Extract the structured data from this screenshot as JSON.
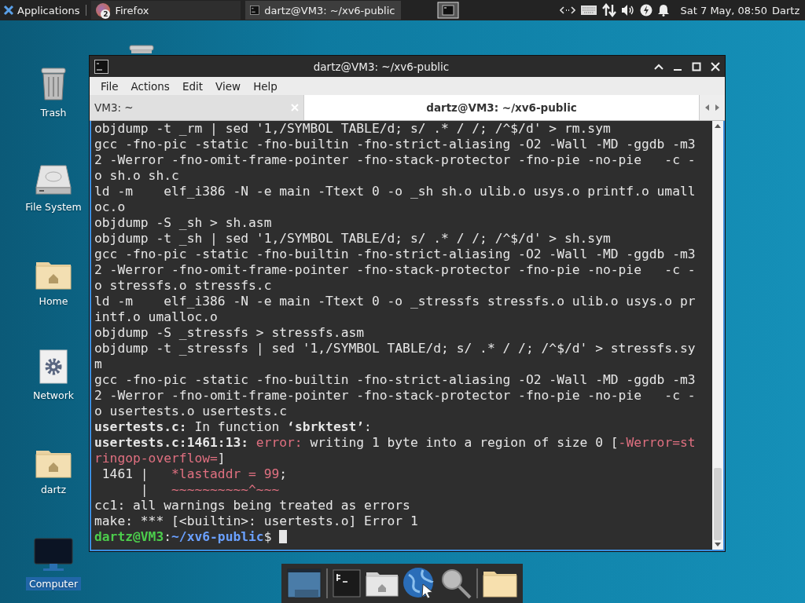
{
  "panel": {
    "menu_label": "Applications",
    "tasks": [
      {
        "label": "Firefox",
        "badge": "2",
        "kind": "browser",
        "selected": false
      },
      {
        "label": "dartz@VM3: ~/xv6-public",
        "kind": "terminal",
        "selected": true
      }
    ],
    "clock": "Sat  7 May, 08:50",
    "user": "Dartz"
  },
  "desktop_icons": [
    {
      "label": "Trash",
      "kind": "trash",
      "selected": false
    },
    {
      "label": "File System",
      "kind": "drive",
      "selected": false
    },
    {
      "label": "Home",
      "kind": "home",
      "selected": false
    },
    {
      "label": "Network",
      "kind": "network",
      "selected": false
    },
    {
      "label": "dartz",
      "kind": "home",
      "selected": false
    },
    {
      "label": "Computer",
      "kind": "computer",
      "selected": true
    }
  ],
  "window": {
    "title": "dartz@VM3: ~/xv6-public",
    "menu": [
      "File",
      "Actions",
      "Edit",
      "View",
      "Help"
    ],
    "tabs": [
      {
        "label": "VM3: ~",
        "selected": false
      },
      {
        "label": "dartz@VM3: ~/xv6-public",
        "selected": true
      }
    ],
    "lines": [
      [
        {
          "t": "objdump -t _rm | sed '1,/SYMBOL TABLE/d; s/ .* / /; /^$/d' > rm.sym",
          "kind": "plain"
        }
      ],
      [
        {
          "t": "gcc -fno-pic -static -fno-builtin -fno-strict-aliasing -O2 -Wall -MD -ggdb -m3",
          "kind": "plain"
        }
      ],
      [
        {
          "t": "2 -Werror -fno-omit-frame-pointer -fno-stack-protector -fno-pie -no-pie   -c -",
          "kind": "plain"
        }
      ],
      [
        {
          "t": "o sh.o sh.c",
          "kind": "plain"
        }
      ],
      [
        {
          "t": "ld -m    elf_i386 -N -e main -Ttext 0 -o _sh sh.o ulib.o usys.o printf.o umall",
          "kind": "plain"
        }
      ],
      [
        {
          "t": "oc.o",
          "kind": "plain"
        }
      ],
      [
        {
          "t": "objdump -S _sh > sh.asm",
          "kind": "plain"
        }
      ],
      [
        {
          "t": "objdump -t _sh | sed '1,/SYMBOL TABLE/d; s/ .* / /; /^$/d' > sh.sym",
          "kind": "plain"
        }
      ],
      [
        {
          "t": "gcc -fno-pic -static -fno-builtin -fno-strict-aliasing -O2 -Wall -MD -ggdb -m3",
          "kind": "plain"
        }
      ],
      [
        {
          "t": "2 -Werror -fno-omit-frame-pointer -fno-stack-protector -fno-pie -no-pie   -c -",
          "kind": "plain"
        }
      ],
      [
        {
          "t": "o stressfs.o stressfs.c",
          "kind": "plain"
        }
      ],
      [
        {
          "t": "ld -m    elf_i386 -N -e main -Ttext 0 -o _stressfs stressfs.o ulib.o usys.o pr",
          "kind": "plain"
        }
      ],
      [
        {
          "t": "intf.o umalloc.o",
          "kind": "plain"
        }
      ],
      [
        {
          "t": "objdump -S _stressfs > stressfs.asm",
          "kind": "plain"
        }
      ],
      [
        {
          "t": "objdump -t _stressfs | sed '1,/SYMBOL TABLE/d; s/ .* / /; /^$/d' > stressfs.sy",
          "kind": "plain"
        }
      ],
      [
        {
          "t": "m",
          "kind": "plain"
        }
      ],
      [
        {
          "t": "gcc -fno-pic -static -fno-builtin -fno-strict-aliasing -O2 -Wall -MD -ggdb -m3",
          "kind": "plain"
        }
      ],
      [
        {
          "t": "2 -Werror -fno-omit-frame-pointer -fno-stack-protector -fno-pie -no-pie   -c -",
          "kind": "plain"
        }
      ],
      [
        {
          "t": "o usertests.o usertests.c",
          "kind": "plain"
        }
      ],
      [
        {
          "t": "usertests.c:",
          "kind": "bold"
        },
        {
          "t": " In function ",
          "kind": "plain"
        },
        {
          "t": "‘sbrktest’",
          "kind": "bold"
        },
        {
          "t": ":",
          "kind": "plain"
        }
      ],
      [
        {
          "t": "usertests.c:1461:13: ",
          "kind": "bold"
        },
        {
          "t": "error:",
          "kind": "error"
        },
        {
          "t": " writing 1 byte into a region of size 0 [",
          "kind": "plain"
        },
        {
          "t": "-Werror=st",
          "kind": "error"
        }
      ],
      [
        {
          "t": "ringop-overflow=",
          "kind": "error"
        },
        {
          "t": "]",
          "kind": "plain"
        }
      ],
      [
        {
          "t": " 1461 |   ",
          "kind": "plain"
        },
        {
          "t": "*lastaddr = 99",
          "kind": "error"
        },
        {
          "t": ";",
          "kind": "plain"
        }
      ],
      [
        {
          "t": "      |   ",
          "kind": "plain"
        },
        {
          "t": "~~~~~~~~~~^~~~",
          "kind": "error"
        }
      ],
      [
        {
          "t": "cc1: all warnings being treated as errors",
          "kind": "plain"
        }
      ],
      [
        {
          "t": "make: *** [<builtin>: usertests.o] Error 1",
          "kind": "plain"
        }
      ],
      [
        {
          "t": "dartz@VM3",
          "kind": "user"
        },
        {
          "t": ":",
          "kind": "plain"
        },
        {
          "t": "~/xv6-public",
          "kind": "path"
        },
        {
          "t": "$ ",
          "kind": "plain"
        }
      ]
    ]
  },
  "dock": [
    {
      "kind": "desktop"
    },
    {
      "kind": "terminal"
    },
    {
      "kind": "home"
    },
    {
      "kind": "browser"
    },
    {
      "kind": "search"
    },
    {
      "kind": "folder"
    }
  ]
}
